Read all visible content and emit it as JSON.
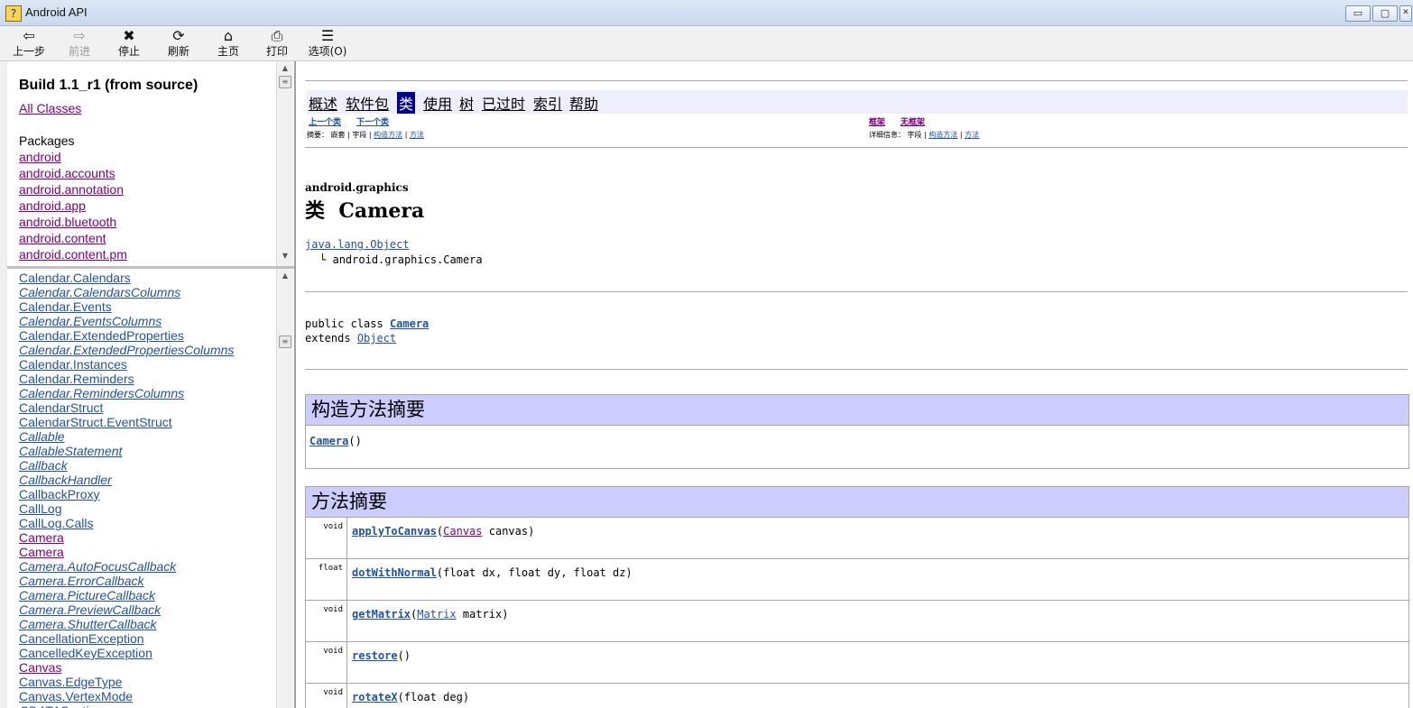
{
  "window": {
    "title": "Android API",
    "icon": "help-file-icon",
    "minimize": "▭",
    "maximize": "▢",
    "close": "✕"
  },
  "toolbar": {
    "buttons": [
      {
        "label": "上一步",
        "icon": "⇦"
      },
      {
        "label": "前进",
        "icon": "⇨"
      },
      {
        "label": "停止",
        "icon": "✖"
      },
      {
        "label": "刷新",
        "icon": "⟳"
      },
      {
        "label": "主页",
        "icon": "⌂"
      },
      {
        "label": "打印",
        "icon": "⎙"
      },
      {
        "label": "选项(O)",
        "icon": "☰"
      }
    ]
  },
  "left_top": {
    "title": "Build 1.1_r1 (from source)",
    "all_classes": "All Classes",
    "packages_label": "Packages",
    "packages": [
      "android",
      "android.accounts",
      "android.annotation",
      "android.app",
      "android.bluetooth",
      "android.content",
      "android.content.pm"
    ]
  },
  "left_bottom": {
    "classes": [
      {
        "name": "Calendar.Calendars",
        "italic": false
      },
      {
        "name": "Calendar.CalendarsColumns",
        "italic": true
      },
      {
        "name": "Calendar.Events",
        "italic": false
      },
      {
        "name": "Calendar.EventsColumns",
        "italic": true
      },
      {
        "name": "Calendar.ExtendedProperties",
        "italic": false
      },
      {
        "name": "Calendar.ExtendedPropertiesColumns",
        "italic": true
      },
      {
        "name": "Calendar.Instances",
        "italic": false
      },
      {
        "name": "Calendar.Reminders",
        "italic": false
      },
      {
        "name": "Calendar.RemindersColumns",
        "italic": true
      },
      {
        "name": "CalendarStruct",
        "italic": false
      },
      {
        "name": "CalendarStruct.EventStruct",
        "italic": false
      },
      {
        "name": "Callable",
        "italic": true
      },
      {
        "name": "CallableStatement",
        "italic": true
      },
      {
        "name": "Callback",
        "italic": true
      },
      {
        "name": "CallbackHandler",
        "italic": true
      },
      {
        "name": "CallbackProxy",
        "italic": false
      },
      {
        "name": "CallLog",
        "italic": false
      },
      {
        "name": "CallLog.Calls",
        "italic": false
      },
      {
        "name": "Camera",
        "italic": false,
        "visited": true
      },
      {
        "name": "Camera",
        "italic": false,
        "visited": true
      },
      {
        "name": "Camera.AutoFocusCallback",
        "italic": true
      },
      {
        "name": "Camera.ErrorCallback",
        "italic": true
      },
      {
        "name": "Camera.PictureCallback",
        "italic": true
      },
      {
        "name": "Camera.PreviewCallback",
        "italic": true
      },
      {
        "name": "Camera.ShutterCallback",
        "italic": true
      },
      {
        "name": "CancellationException",
        "italic": false
      },
      {
        "name": "CancelledKeyException",
        "italic": false
      },
      {
        "name": "Canvas",
        "italic": false,
        "visited": true
      },
      {
        "name": "Canvas.EdgeType",
        "italic": false
      },
      {
        "name": "Canvas.VertexMode",
        "italic": false
      },
      {
        "name": "CDATASection",
        "italic": true
      }
    ]
  },
  "content": {
    "nav": [
      "概述",
      "软件包",
      "类",
      "使用",
      "树",
      "已过时",
      "索引",
      "帮助"
    ],
    "nav_active": "类",
    "prev_class": "上一个类",
    "next_class": "下一个类",
    "frames": "框架",
    "no_frames": "无框架",
    "summary_label": "摘要：",
    "summary_nested": "嵌套",
    "summary_field": "字段",
    "summary_constructor": "构造方法",
    "summary_method": "方法",
    "detail_label": "详细信息：",
    "detail_field": "字段",
    "detail_constructor": "构造方法",
    "detail_method": "方法",
    "sep": "|",
    "package": "android.graphics",
    "class_title_prefix": "类",
    "class_title_name": "Camera",
    "hierarchy_root": "java.lang.Object",
    "hierarchy_child": "android.graphics.Camera",
    "decl_public": "public class",
    "decl_name": "Camera",
    "decl_extends": "extends",
    "decl_super": "Object",
    "constructor_summary_title": "构造方法摘要",
    "constructor_name": "Camera",
    "constructor_params": "()",
    "method_summary_title": "方法摘要",
    "methods": [
      {
        "type": "void",
        "name": "applyToCanvas",
        "param_link": "Canvas",
        "params": " canvas)"
      },
      {
        "type": "float",
        "name": "dotWithNormal",
        "params": "(float dx, float dy, float dz)"
      },
      {
        "type": "void",
        "name": "getMatrix",
        "param_link": "Matrix",
        "params": " matrix)"
      },
      {
        "type": "void",
        "name": "restore",
        "params": "()"
      },
      {
        "type": "void",
        "name": "rotateX",
        "params": "(float deg)"
      }
    ]
  }
}
